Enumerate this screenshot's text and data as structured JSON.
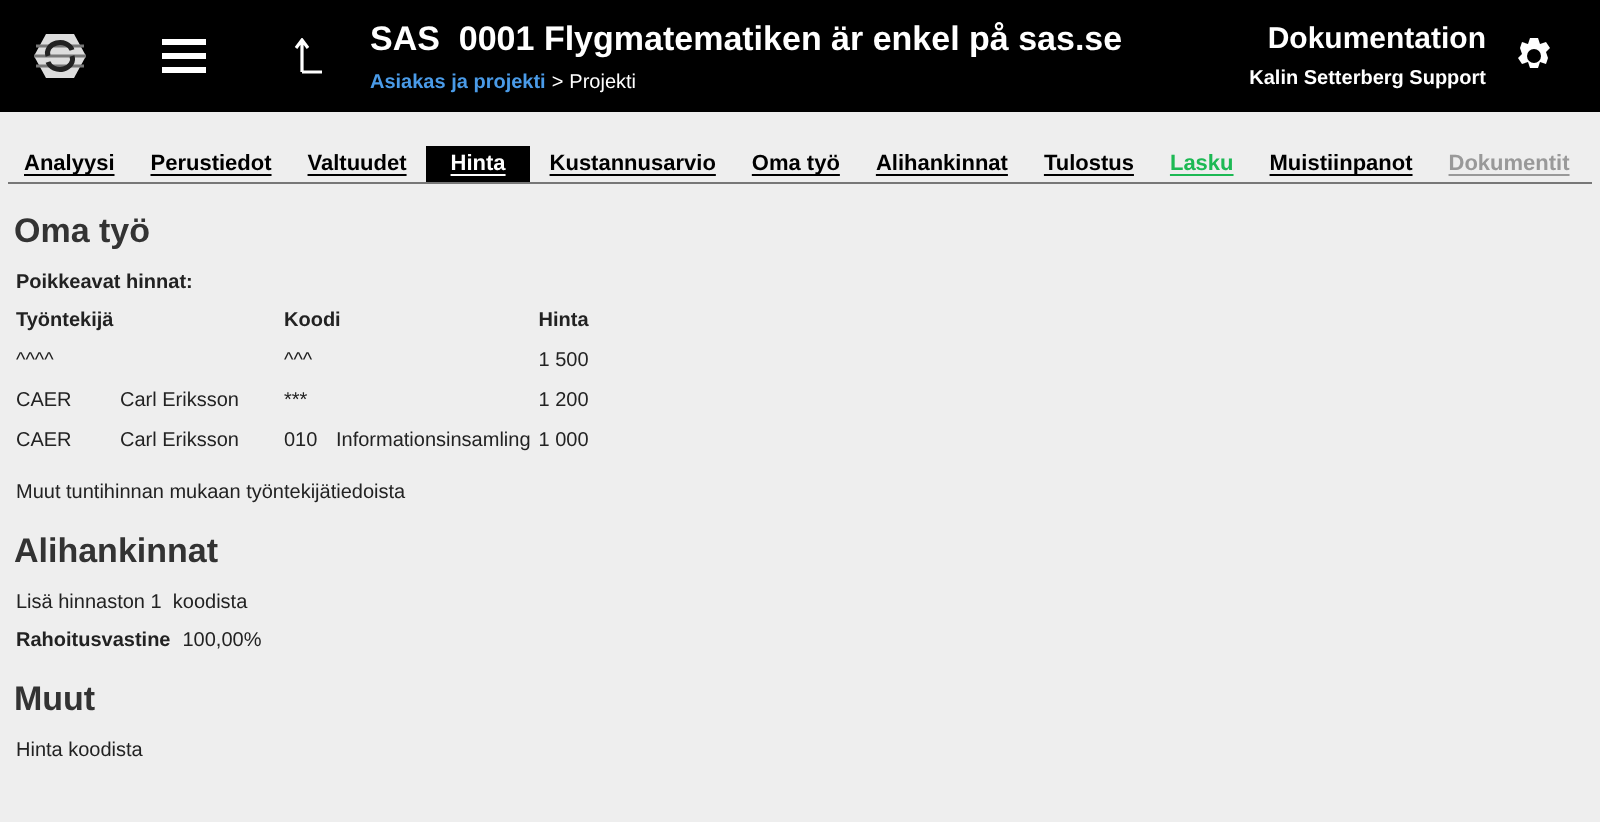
{
  "header": {
    "title": "SAS  0001 Flygmatematiken är enkel på sas.se",
    "breadcrumb": {
      "link": "Asiakas ja projekti",
      "separator": ">",
      "current": "Projekti"
    },
    "module": "Dokumentation",
    "user": "Kalin Setterberg Support"
  },
  "tabs": [
    {
      "label": "Analyysi",
      "selected": false,
      "disabled": false,
      "highlighted": false
    },
    {
      "label": "Perustiedot",
      "selected": false,
      "disabled": false,
      "highlighted": false
    },
    {
      "label": "Valtuudet",
      "selected": false,
      "disabled": false,
      "highlighted": false
    },
    {
      "label": "Hinta",
      "selected": true,
      "disabled": false,
      "highlighted": false
    },
    {
      "label": "Kustannusarvio",
      "selected": false,
      "disabled": false,
      "highlighted": false
    },
    {
      "label": "Oma työ",
      "selected": false,
      "disabled": false,
      "highlighted": false
    },
    {
      "label": "Alihankinnat",
      "selected": false,
      "disabled": false,
      "highlighted": false
    },
    {
      "label": "Tulostus",
      "selected": false,
      "disabled": false,
      "highlighted": false
    },
    {
      "label": "Lasku",
      "selected": false,
      "disabled": false,
      "highlighted": true
    },
    {
      "label": "Muistiinpanot",
      "selected": false,
      "disabled": false,
      "highlighted": false
    },
    {
      "label": "Dokumentit",
      "selected": false,
      "disabled": true,
      "highlighted": false
    }
  ],
  "own_work": {
    "heading": "Oma työ",
    "subheading": "Poikkeavat hinnat:",
    "columns": [
      "Työntekijä",
      "Koodi",
      "Hinta"
    ],
    "rows": [
      {
        "employee_code": "^^^^",
        "employee_name": "",
        "code": "^^^",
        "code_name": "",
        "price": "1 500"
      },
      {
        "employee_code": "CAER",
        "employee_name": "Carl Eriksson",
        "code": "***",
        "code_name": "",
        "price": "1 200"
      },
      {
        "employee_code": "CAER",
        "employee_name": "Carl Eriksson",
        "code": "010",
        "code_name": "Informationsinsamling",
        "price": "1 000"
      }
    ],
    "note": "Muut tuntihinnan mukaan työntekijätiedoista"
  },
  "subcontracting": {
    "heading": "Alihankinnat",
    "note": "Lisä hinnaston 1  koodista",
    "field_label": "Rahoitusvastine",
    "field_value": "100,00%"
  },
  "other": {
    "heading": "Muut",
    "note": "Hinta koodista"
  }
}
